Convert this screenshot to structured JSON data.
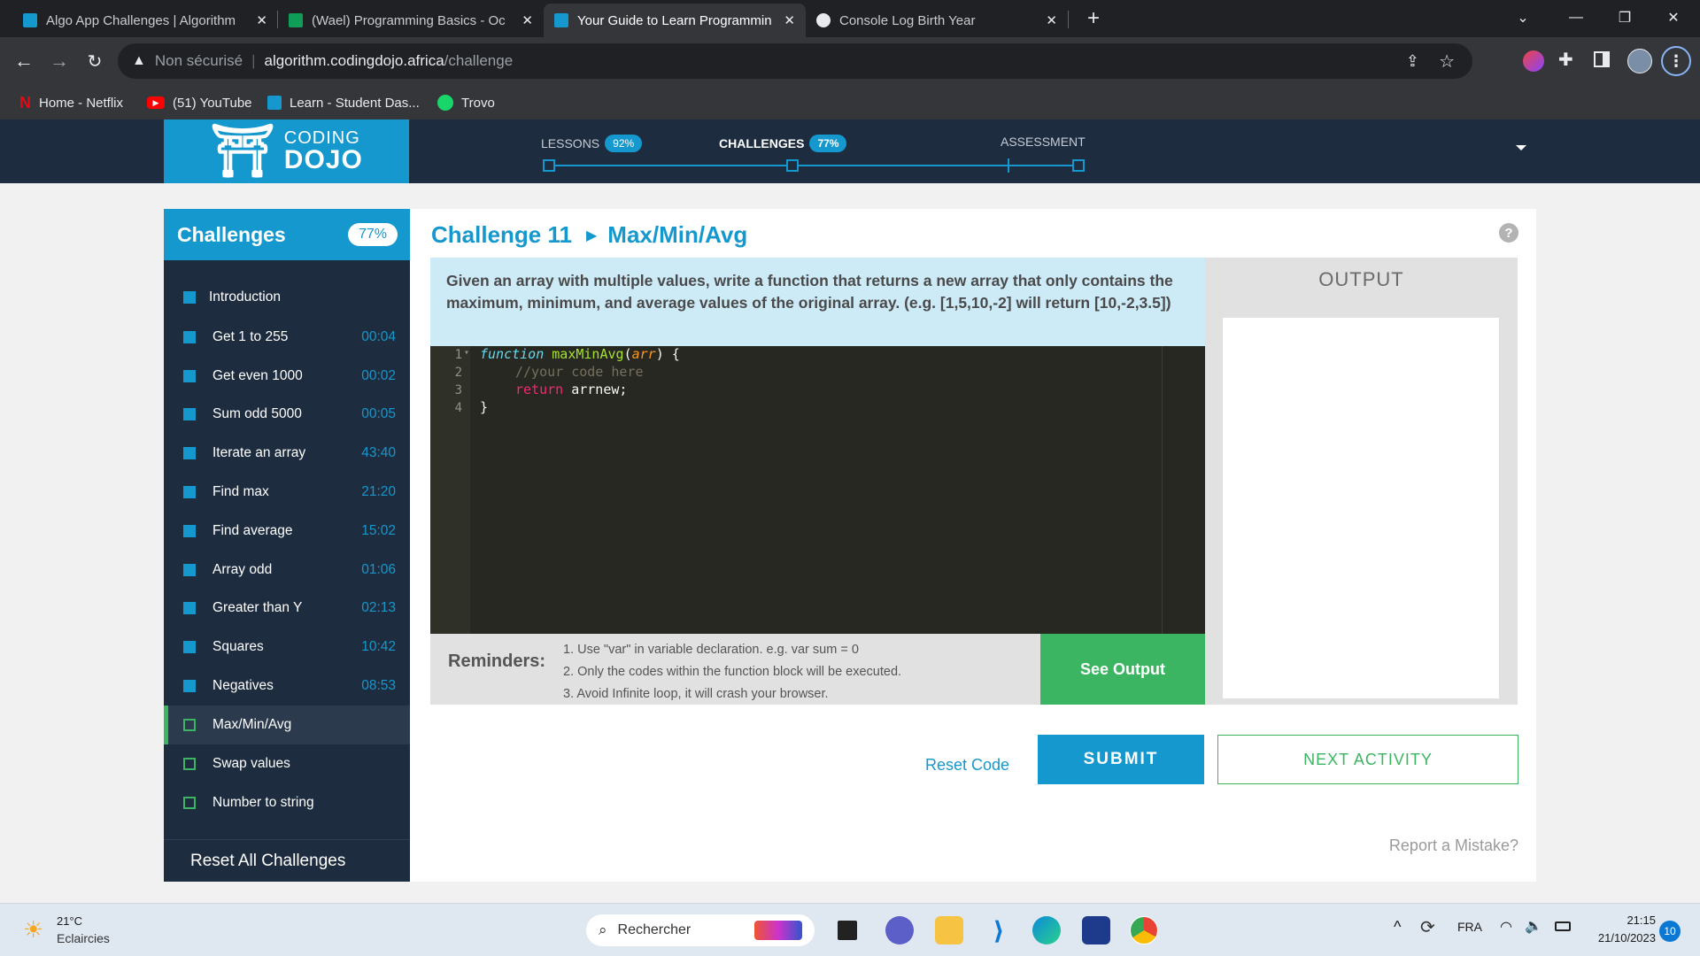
{
  "browser": {
    "tabs": [
      {
        "title": "Algo App Challenges | Algorithm",
        "favicon_color": "#1598cd",
        "active": false
      },
      {
        "title": "(Wael) Programming Basics - Oc",
        "favicon_color": "#0f9d58",
        "active": false
      },
      {
        "title": "Your Guide to Learn Programmin",
        "favicon_color": "#1598cd",
        "active": true
      },
      {
        "title": "Console Log Birth Year",
        "favicon_color": "#e8eaed",
        "active": false
      }
    ],
    "new_tab": "+",
    "address": {
      "security": "Non sécurisé",
      "host": "algorithm.codingdojo.africa",
      "path": "/challenge"
    },
    "bookmarks": [
      {
        "label": "Home - Netflix",
        "icon": "netflix-icon",
        "color": "#e50914"
      },
      {
        "label": "(51) YouTube",
        "icon": "youtube-icon",
        "color": "#ff0000"
      },
      {
        "label": "Learn - Student Das...",
        "icon": "codingdojo-icon",
        "color": "#1598cd"
      },
      {
        "label": "Trovo",
        "icon": "trovo-icon",
        "color": "#19d66b"
      }
    ]
  },
  "header": {
    "logo_top": "CODING",
    "logo_bottom": "DOJO",
    "progress": [
      {
        "label": "LESSONS",
        "pct": "92%"
      },
      {
        "label": "CHALLENGES",
        "pct": "77%"
      },
      {
        "label": "ASSESSMENT",
        "pct": ""
      }
    ]
  },
  "sidebar": {
    "title": "Challenges",
    "badge": "77%",
    "items": [
      {
        "label": "Introduction",
        "time": ""
      },
      {
        "label": "Get 1 to 255",
        "time": "00:04"
      },
      {
        "label": "Get even 1000",
        "time": "00:02"
      },
      {
        "label": "Sum odd 5000",
        "time": "00:05"
      },
      {
        "label": "Iterate an array",
        "time": "43:40"
      },
      {
        "label": "Find max",
        "time": "21:20"
      },
      {
        "label": "Find average",
        "time": "15:02"
      },
      {
        "label": "Array odd",
        "time": "01:06"
      },
      {
        "label": "Greater than Y",
        "time": "02:13"
      },
      {
        "label": "Squares",
        "time": "10:42"
      },
      {
        "label": "Negatives",
        "time": "08:53"
      },
      {
        "label": "Max/Min/Avg",
        "time": ""
      },
      {
        "label": "Swap values",
        "time": ""
      },
      {
        "label": "Number to string",
        "time": ""
      }
    ],
    "reset_all": "Reset All Challenges"
  },
  "challenge": {
    "number": "Challenge 11",
    "name": "Max/Min/Avg",
    "description": "Given an array with multiple values, write a function that returns a new array that only contains the maximum, minimum, and average values of the original array. (e.g. [1,5,10,-2] will return [10,-2,3.5])",
    "help": "?"
  },
  "editor": {
    "line_numbers": [
      "1",
      "2",
      "3",
      "4"
    ],
    "line1": {
      "kw": "function",
      "name": "maxMinAvg",
      "open": "(",
      "param": "arr",
      "close": ") {"
    },
    "line2": "//your code here",
    "line3": {
      "kw": "return",
      "rest": " arrnew;"
    },
    "line4": "}"
  },
  "output": {
    "title": "OUTPUT"
  },
  "reminders": {
    "label": "Reminders:",
    "lines": [
      "1. Use \"var\" in variable declaration. e.g. var sum = 0",
      "2. Only the codes within the function block will be executed.",
      "3. Avoid Infinite loop, it will crash your browser."
    ]
  },
  "actions": {
    "see_output": "See Output",
    "reset_code": "Reset Code",
    "submit": "SUBMIT",
    "next": "NEXT ACTIVITY",
    "report": "Report a Mistake?"
  },
  "taskbar": {
    "weather_temp": "21°C",
    "weather_desc": "Eclaircies",
    "search": "Rechercher",
    "lang": "FRA",
    "time": "21:15",
    "date": "21/10/2023",
    "notif": "10"
  }
}
